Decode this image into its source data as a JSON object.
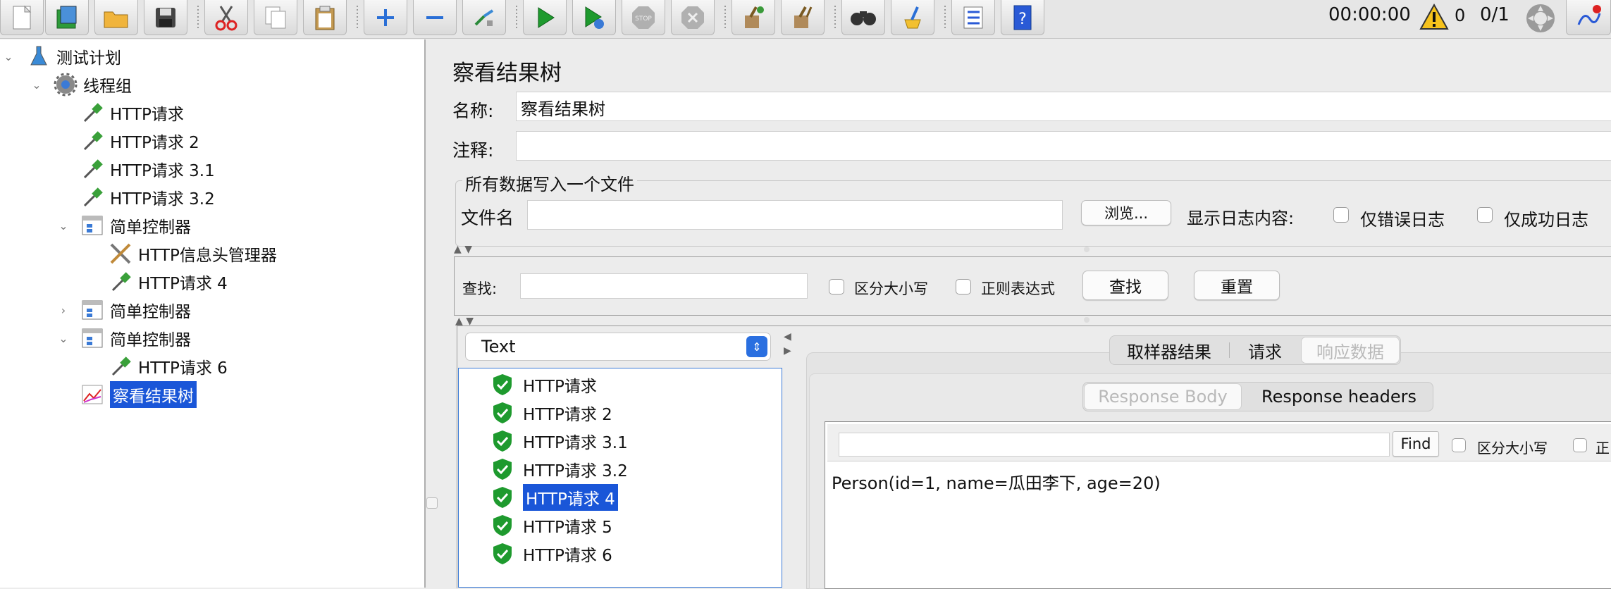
{
  "toolbar": {
    "timer": "00:00:00",
    "warning_count": "0",
    "threads": "0/1",
    "buttons": [
      "new-icon",
      "templates-icon",
      "open-icon",
      "save-icon",
      "cut-icon",
      "copy-icon",
      "paste-icon",
      "expand-icon",
      "collapse-icon",
      "toggle-icon",
      "start-icon",
      "start-no-pause-icon",
      "stop-icon",
      "shutdown-icon",
      "clear-icon",
      "clear-all-icon",
      "search-icon",
      "reset-search-icon",
      "function-helper-icon",
      "help-icon"
    ]
  },
  "tree": {
    "items": [
      {
        "label": "测试计划",
        "icon": "flask-icon"
      },
      {
        "label": "线程组",
        "icon": "gear-icon"
      },
      {
        "label": "HTTP请求",
        "icon": "pipette-icon"
      },
      {
        "label": "HTTP请求 2",
        "icon": "pipette-icon"
      },
      {
        "label": "HTTP请求 3.1",
        "icon": "pipette-icon"
      },
      {
        "label": "HTTP请求 3.2",
        "icon": "pipette-icon"
      },
      {
        "label": "简单控制器",
        "icon": "controller-icon"
      },
      {
        "label": "HTTP信息头管理器",
        "icon": "tools-icon"
      },
      {
        "label": "HTTP请求 4",
        "icon": "pipette-icon"
      },
      {
        "label": "简单控制器",
        "icon": "controller-icon"
      },
      {
        "label": "简单控制器",
        "icon": "controller-icon"
      },
      {
        "label": "HTTP请求 6",
        "icon": "pipette-icon"
      },
      {
        "label": "察看结果树",
        "icon": "graph-icon"
      }
    ]
  },
  "panel": {
    "title": "察看结果树",
    "name_label": "名称:",
    "name_value": "察看结果树",
    "comment_label": "注释:",
    "comment_value": "",
    "file_group_title": "所有数据写入一个文件",
    "filename_label": "文件名",
    "filename_value": "",
    "browse_label": "浏览...",
    "log_display_label": "显示日志内容:",
    "errors_only_label": "仅错误日志",
    "success_only_label": "仅成功日志"
  },
  "search": {
    "label": "查找:",
    "value": "",
    "case_label": "区分大小写",
    "regex_label": "正则表达式",
    "find_label": "查找",
    "reset_label": "重置"
  },
  "results": {
    "renderer": "Text",
    "items": [
      "HTTP请求",
      "HTTP请求 2",
      "HTTP请求 3.1",
      "HTTP请求 3.2",
      "HTTP请求 4",
      "HTTP请求 5",
      "HTTP请求 6"
    ],
    "selected_index": 4
  },
  "detail": {
    "tabs": [
      "取样器结果",
      "请求",
      "响应数据"
    ],
    "subtabs": [
      "Response Body",
      "Response headers"
    ],
    "find_button": "Find",
    "case_label": "区分大小写",
    "regex_partial": "正",
    "body_text": "Person(id=1, name=瓜田李下, age=20)"
  }
}
